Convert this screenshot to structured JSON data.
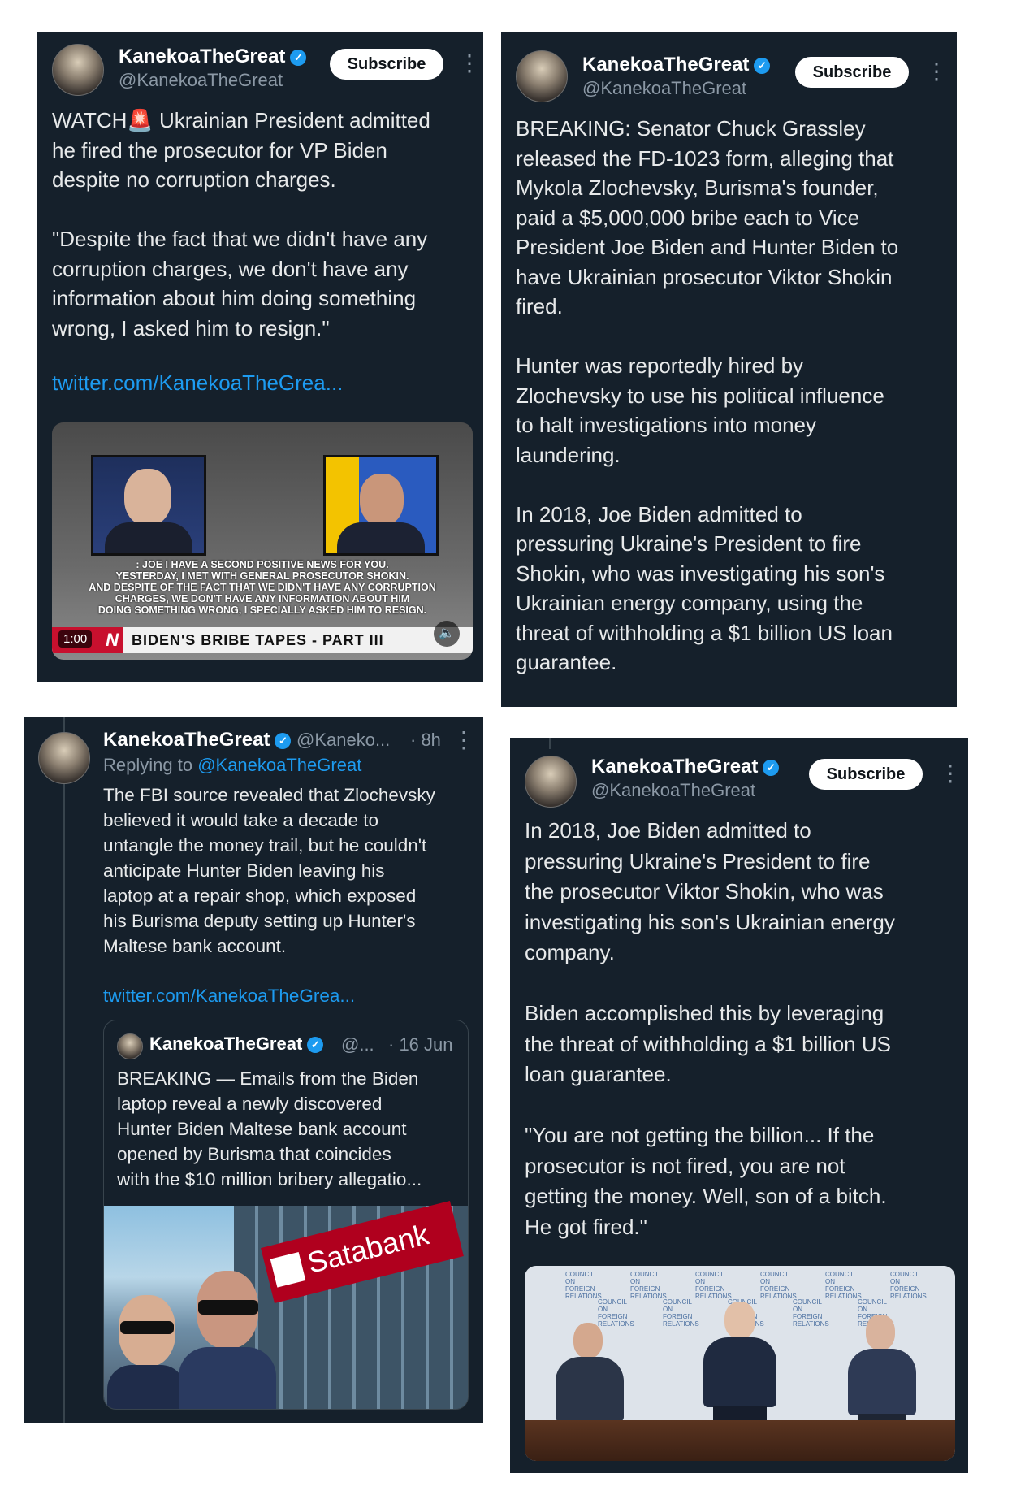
{
  "tweet1": {
    "name": "KanekoaTheGreat",
    "handle": "@KanekoaTheGreat",
    "subscribe": "Subscribe",
    "text": "WATCH🚨 Ukrainian President admitted\nhe fired the prosecutor for VP Biden\ndespite no corruption charges.\n\n\"Despite the fact that we didn't have any\ncorruption charges, we don't have any\ninformation about him doing something\nwrong, I asked him to resign.\"",
    "link": "twitter.com/KanekoaTheGrea...",
    "video": {
      "caption_lines": [
        ": JOE I HAVE A SECOND POSITIVE NEWS FOR YOU.",
        "YESTERDAY, I MET WITH GENERAL PROSECUTOR SHOKIN.",
        "AND DESPITE OF THE FACT THAT WE DIDN'T HAVE ANY CORRUPTION",
        "CHARGES, WE DON'T HAVE ANY INFORMATION ABOUT HIM",
        "DOING SOMETHING WRONG, I SPECIALLY ASKED HIM TO RESIGN."
      ],
      "ticker": "BIDEN'S BRIBE TAPES - PART III",
      "duration": "1:00",
      "network": "N"
    }
  },
  "tweet2": {
    "name": "KanekoaTheGreat",
    "handle": "@KanekoaTheGreat",
    "subscribe": "Subscribe",
    "text": "BREAKING: Senator Chuck Grassley\nreleased the FD-1023 form, alleging that\nMykola Zlochevsky, Burisma's founder,\npaid a $5,000,000 bribe each to Vice\nPresident Joe Biden and Hunter Biden to\nhave Ukrainian prosecutor Viktor Shokin\nfired.\n\nHunter was reportedly hired by\nZlochevsky to use his political influence\nto halt investigations into money\nlaundering.\n\nIn 2018, Joe Biden admitted to\npressuring Ukraine's President to fire\nShokin, who was investigating his son's\nUkrainian energy company, using the\nthreat of withholding a $1 billion US loan\nguarantee."
  },
  "tweet3": {
    "name": "KanekoaTheGreat",
    "handle": "@Kaneko...",
    "time": "· 8h",
    "replying_prefix": "Replying to ",
    "replying_to": "@KanekoaTheGreat",
    "text": "The FBI source revealed that Zlochevsky\nbelieved it would take a decade to\nuntangle the money trail, but he couldn't\nanticipate Hunter Biden leaving his\nlaptop at a repair shop, which exposed\nhis Burisma deputy setting up Hunter's\nMaltese bank account.",
    "link": "twitter.com/KanekoaTheGrea...",
    "quote": {
      "name": "KanekoaTheGreat",
      "handle": "@...",
      "time": "· 16 Jun",
      "text": "BREAKING — Emails from the Biden\nlaptop reveal a newly discovered\nHunter Biden Maltese bank account\nopened by Burisma that coincides\nwith the $10 million bribery allegatio...",
      "image_sign": "Satabank"
    }
  },
  "tweet4": {
    "name": "KanekoaTheGreat",
    "handle": "@KanekoaTheGreat",
    "subscribe": "Subscribe",
    "text": "In 2018, Joe Biden admitted to\npressuring Ukraine's President to fire\nthe prosecutor Viktor Shokin, who was\ninvestigating his son's Ukrainian energy\ncompany.\n\nBiden accomplished this by leveraging\nthe threat of withholding a $1 billion US\nloan guarantee.\n\n\"You are not getting the billion... If the\nprosecutor is not fired, you are not\ngetting the money. Well, son of a bitch.\nHe got fired.\"",
    "backdrop_text": "COUNCIL ON FOREIGN RELATIONS"
  },
  "colors": {
    "card_bg": "#15202b",
    "text": "#e7e9ea",
    "muted": "#8b98a5",
    "link": "#1d9bf0",
    "verified": "#1d9bf0",
    "breaking_red": "#d0021b"
  }
}
